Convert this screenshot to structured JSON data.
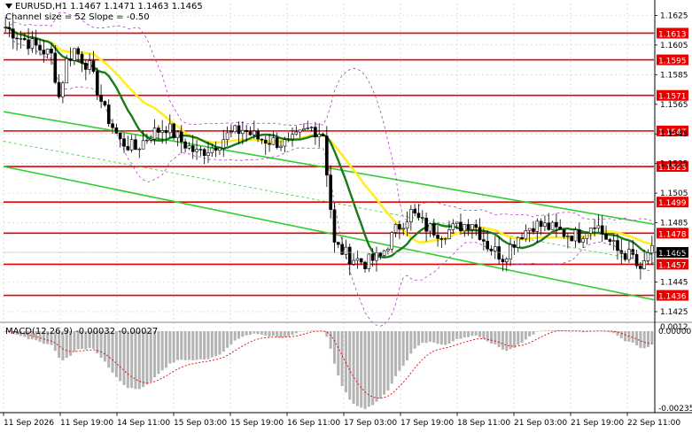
{
  "chart_data": {
    "type": "candlestick",
    "symbol_line": "EURUSD,H1  1.1467 1.1471 1.1463 1.1465",
    "indicator_line": "Channel size = 52 Slope = -0.50",
    "macd_label": "MACD(12,26,9) -0.00032 -0.00027",
    "price_ylim": [
      1.1419,
      1.1633
    ],
    "current_price": "1.1465",
    "price_ticks": [
      "1.1625",
      "1.1605",
      "1.1585",
      "1.1565",
      "1.1545",
      "1.1525",
      "1.1505",
      "1.1485",
      "1.1465",
      "1.1445",
      "1.1425"
    ],
    "levels": [
      {
        "value": 1.1613,
        "label": "1.1613"
      },
      {
        "value": 1.1595,
        "label": "1.1595"
      },
      {
        "value": 1.1571,
        "label": "1.1571"
      },
      {
        "value": 1.1547,
        "label": "1.1547"
      },
      {
        "value": 1.1523,
        "label": "1.1523"
      },
      {
        "value": 1.1499,
        "label": "1.1499"
      },
      {
        "value": 1.1478,
        "label": "1.1478"
      },
      {
        "value": 1.1457,
        "label": "1.1457"
      },
      {
        "value": 1.1436,
        "label": "1.1436"
      }
    ],
    "macd_ticks": [
      "0.00000",
      "-0.00235"
    ],
    "macd_top_tick": "0.0012",
    "x_labels": [
      "11 Sep 2026",
      "11 Sep 19:00",
      "14 Sep 11:00",
      "15 Sep 03:00",
      "15 Sep 19:00",
      "16 Sep 11:00",
      "17 Sep 03:00",
      "17 Sep 19:00",
      "18 Sep 11:00",
      "21 Sep 03:00",
      "21 Sep 19:00",
      "22 Sep 11:00"
    ],
    "close_path": [
      [
        0,
        1.1617
      ],
      [
        4,
        1.161
      ],
      [
        8,
        1.1604
      ],
      [
        12,
        1.1598
      ],
      [
        14,
        1.157
      ],
      [
        16,
        1.1594
      ],
      [
        18,
        1.1602
      ],
      [
        22,
        1.159
      ],
      [
        26,
        1.156
      ],
      [
        30,
        1.154
      ],
      [
        34,
        1.1535
      ],
      [
        38,
        1.1545
      ],
      [
        42,
        1.155
      ],
      [
        46,
        1.154
      ],
      [
        50,
        1.1532
      ],
      [
        54,
        1.1536
      ],
      [
        58,
        1.1544
      ],
      [
        62,
        1.1548
      ],
      [
        66,
        1.1542
      ],
      [
        70,
        1.154
      ],
      [
        74,
        1.1538
      ],
      [
        78,
        1.1546
      ],
      [
        80,
        1.1549
      ],
      [
        83,
        1.1545
      ],
      [
        86,
        1.147
      ],
      [
        90,
        1.1462
      ],
      [
        94,
        1.1458
      ],
      [
        98,
        1.1462
      ],
      [
        102,
        1.148
      ],
      [
        106,
        1.1492
      ],
      [
        110,
        1.1482
      ],
      [
        114,
        1.1478
      ],
      [
        118,
        1.1482
      ],
      [
        122,
        1.1486
      ],
      [
        126,
        1.147
      ],
      [
        130,
        1.1462
      ],
      [
        134,
        1.1476
      ],
      [
        138,
        1.1484
      ],
      [
        142,
        1.1482
      ],
      [
        146,
        1.1478
      ],
      [
        150,
        1.1476
      ],
      [
        154,
        1.1486
      ],
      [
        156,
        1.1478
      ],
      [
        160,
        1.1466
      ],
      [
        164,
        1.1462
      ],
      [
        166,
        1.145
      ],
      [
        168,
        1.1465
      ]
    ],
    "legend": [],
    "grid": true
  }
}
